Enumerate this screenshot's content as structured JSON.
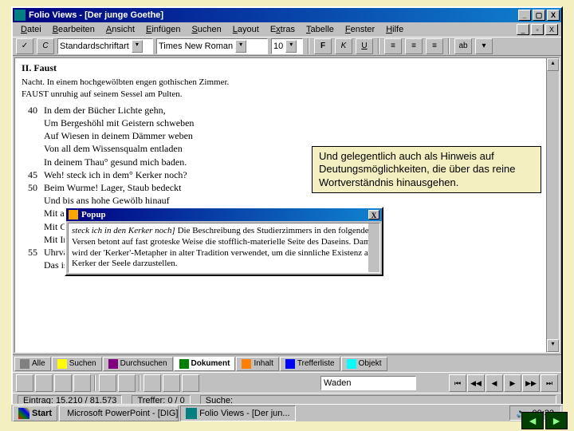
{
  "app": {
    "title": "Folio Views - [Der junge Goethe]"
  },
  "menu": [
    "Datei",
    "Bearbeiten",
    "Ansicht",
    "Einfügen",
    "Suchen",
    "Layout",
    "Extras",
    "Tabelle",
    "Fenster",
    "Hilfe"
  ],
  "toolbar": {
    "style_label": "Standardschriftart",
    "font": "Times New Roman",
    "size": "10",
    "b": "F",
    "i": "K",
    "u": "U"
  },
  "text": {
    "heading": "II. Faust",
    "sub1": "Nacht. In einem hochgewölbten engen gothischen Zimmer.",
    "sub2": "FAUST unruhig auf seinem Sessel am Pulten.",
    "lines": [
      {
        "n": "40",
        "t": "In dem der Bücher Lichte gehn,"
      },
      {
        "n": "",
        "t": "Um Bergeshöhl mit Geistern schweben"
      },
      {
        "n": "",
        "t": "Auf Wiesen in deinem Dämmer weben"
      },
      {
        "n": "",
        "t": "Von all dem Wissensqualm entladen"
      },
      {
        "n": "",
        "t": "In deinem Thau° gesund mich baden."
      },
      {
        "n": "",
        "t": ""
      },
      {
        "n": "45",
        "t": "Weh! steck ich in dem° Kerker noch?"
      },
      {
        "n": "",
        "t": ""
      },
      {
        "n": "",
        "t": ""
      },
      {
        "n": "",
        "t": ""
      },
      {
        "n": "",
        "t": ""
      },
      {
        "n": "50",
        "t": "Beim Wurme! Lager, Staub bedeckt"
      },
      {
        "n": "",
        "t": "Und bis ans hohe Gewölb hinauf"
      },
      {
        "n": "",
        "t": "Mit angeraucht Papier besteckt"
      },
      {
        "n": "",
        "t": "Mit Gläsern Büchsen rings bestellt"
      },
      {
        "n": "",
        "t": "Mit Instrumenten vollgepropft"
      },
      {
        "n": "55",
        "t": "Uhrväter Hausrath drein gestopft,"
      },
      {
        "n": "",
        "t": "Das ist deine Welt, das heisst eine Welt."
      }
    ]
  },
  "overlay": "Und gelegentlich auch als Hinweis auf Deutungsmöglichkeiten, die über das reine Wortverständnis hinausgehen.",
  "popup": {
    "title": "Popup",
    "bold": "steck ich in den Kerker noch]",
    "body": " Die Beschreibung des Studierzimmers in den folgenden Versen betont auf fast groteske Weise die stofflich-materielle Seite des Daseins. Damit wird der 'Kerker'-Metapher in alter Tradition verwendet, um die sinnliche Existenz als Kerker der Seele darzustellen."
  },
  "tabs": [
    "Alle",
    "Suchen",
    "Durchsuchen",
    "Dokument",
    "Inhalt",
    "Trefferliste",
    "Objekt"
  ],
  "tb2_field": "Waden",
  "status": {
    "entry": "Eintrag: 15.210 / 81.573",
    "hits": "Treffer: 0 / 0",
    "search": "Suche:"
  },
  "taskbar": {
    "start": "Start",
    "tasks": [
      "Microsoft PowerPoint - [DIG]",
      "Folio Views - [Der jun..."
    ],
    "time": "09:32"
  }
}
